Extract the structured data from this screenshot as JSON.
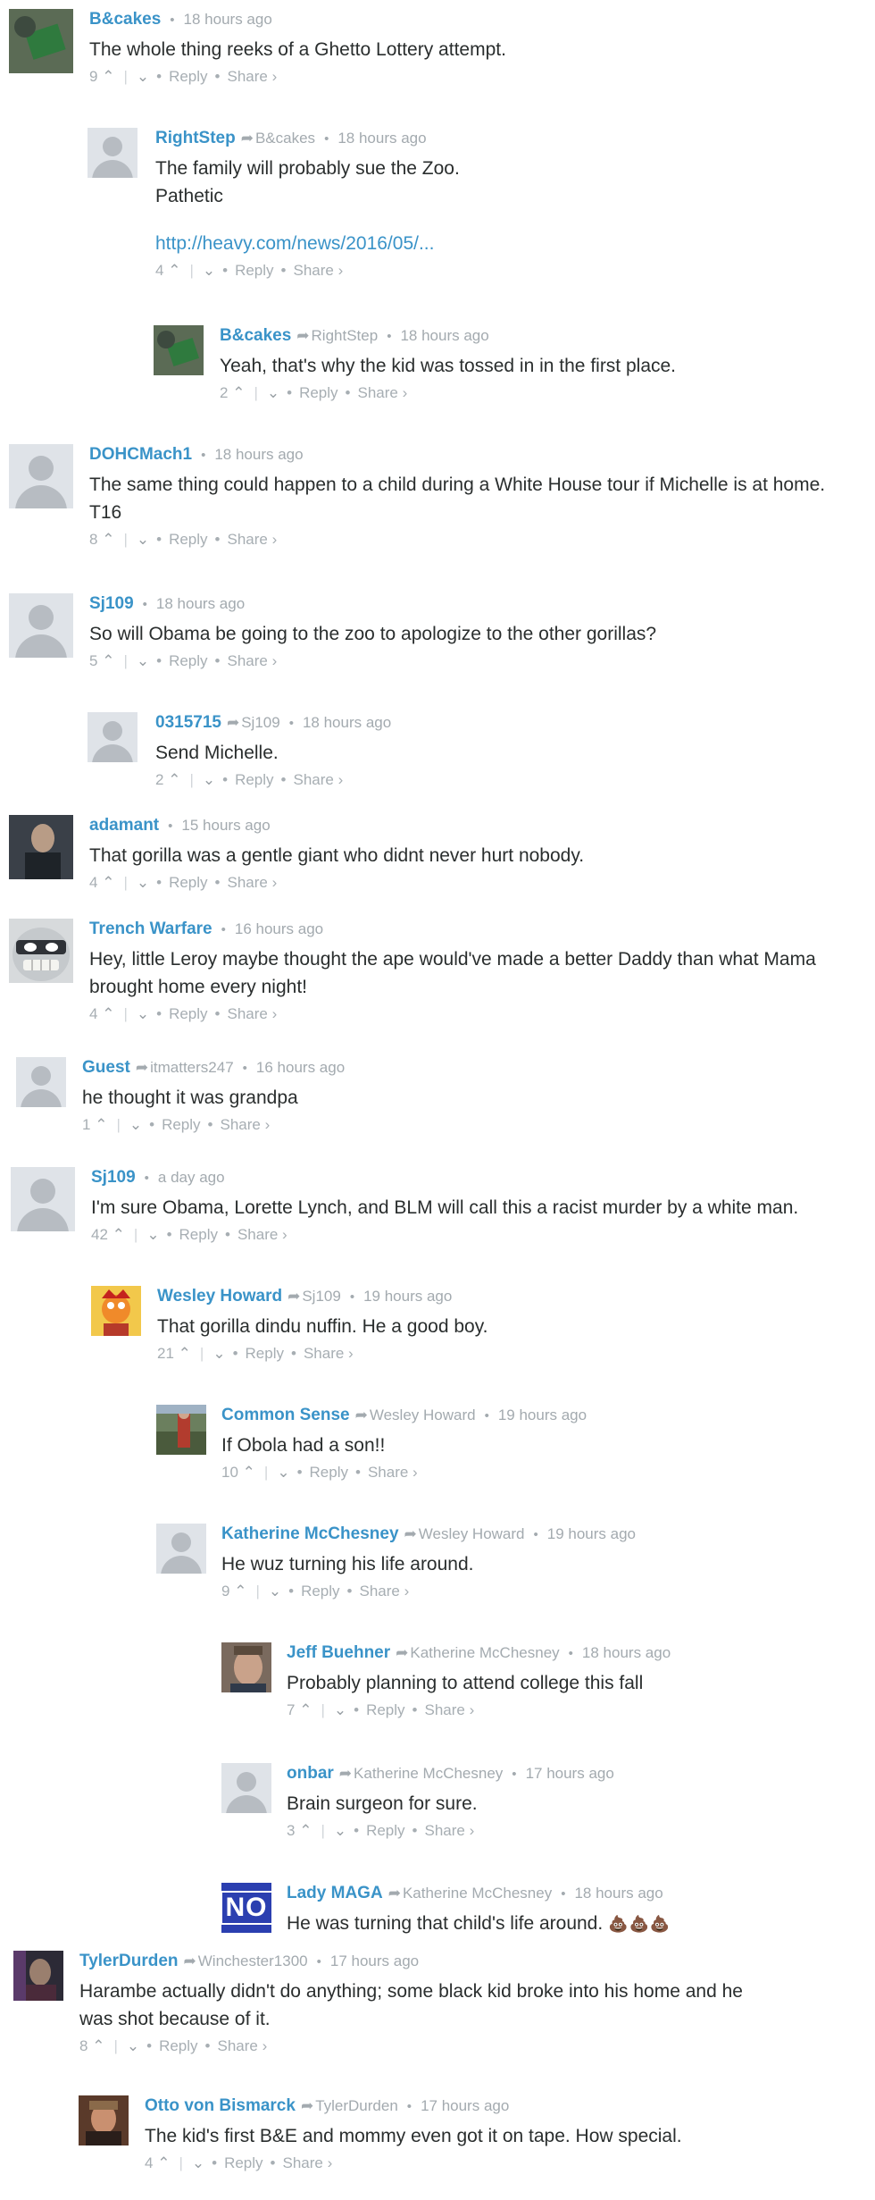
{
  "ui": {
    "reply": "Reply",
    "share": "Share ›",
    "dot": "•",
    "sep": "·",
    "up": "⌃",
    "down": "⌄",
    "bar": "|"
  },
  "comments": [
    {
      "author": "B&cakes",
      "parent": "",
      "time": "18 hours ago",
      "lines": [
        "The whole thing reeks of a Ghetto Lottery attempt."
      ],
      "votes": "9"
    },
    {
      "author": "RightStep",
      "parent": "B&cakes",
      "time": "18 hours ago",
      "lines": [
        "The family will probably sue the Zoo.",
        "Pathetic"
      ],
      "link": "http://heavy.com/news/2016/05/...",
      "votes": "4"
    },
    {
      "author": "B&cakes",
      "parent": "RightStep",
      "time": "18 hours ago",
      "lines": [
        "Yeah, that's why the kid was tossed in in the first place."
      ],
      "votes": "2"
    },
    {
      "author": "DOHCMach1",
      "parent": "",
      "time": "18 hours ago",
      "lines": [
        "The same thing could happen to a child during a White House tour if Michelle is at home.",
        "T16"
      ],
      "votes": "8"
    },
    {
      "author": "Sj109",
      "parent": "",
      "time": "18 hours ago",
      "lines": [
        "So will Obama be going to the zoo to apologize to the other gorillas?"
      ],
      "votes": "5"
    },
    {
      "author": "0315715",
      "parent": "Sj109",
      "time": "18 hours ago",
      "lines": [
        "Send Michelle."
      ],
      "votes": "2"
    },
    {
      "author": "adamant",
      "parent": "",
      "time": "15 hours ago",
      "lines": [
        "That gorilla was a gentle giant who didnt never hurt nobody."
      ],
      "votes": "4"
    },
    {
      "author": "Trench Warfare",
      "parent": "",
      "time": "16 hours ago",
      "lines": [
        "Hey, little Leroy maybe thought the ape would've made a better Daddy than what Mama",
        "brought home every night!"
      ],
      "votes": "4"
    },
    {
      "author": "Guest",
      "parent": "itmatters247",
      "time": "16 hours ago",
      "lines": [
        "he thought it was grandpa"
      ],
      "votes": "1"
    },
    {
      "author": "Sj109",
      "parent": "",
      "time": "a day ago",
      "lines": [
        "I'm sure Obama, Lorette Lynch, and BLM will call this a racist murder by a white man."
      ],
      "votes": "42"
    },
    {
      "author": "Wesley Howard",
      "parent": "Sj109",
      "time": "19 hours ago",
      "lines": [
        "That gorilla dindu nuffin. He a good boy."
      ],
      "votes": "21"
    },
    {
      "author": "Common Sense",
      "parent": "Wesley Howard",
      "time": "19 hours ago",
      "lines": [
        "If Obola had a son!!"
      ],
      "votes": "10"
    },
    {
      "author": "Katherine McChesney",
      "parent": "Wesley Howard",
      "time": "19 hours ago",
      "lines": [
        "He wuz turning his life around."
      ],
      "votes": "9"
    },
    {
      "author": "Jeff Buehner",
      "parent": "Katherine McChesney",
      "time": "18 hours ago",
      "lines": [
        "Probably planning to attend college this fall"
      ],
      "votes": "7"
    },
    {
      "author": "onbar",
      "parent": "Katherine McChesney",
      "time": "17 hours ago",
      "lines": [
        "Brain surgeon for sure."
      ],
      "votes": "3"
    },
    {
      "author": "Lady MAGA",
      "parent": "Katherine McChesney",
      "time": "18 hours ago",
      "lines": [
        "He was turning that child's life around."
      ],
      "emoji": "💩💩💩",
      "badge": "NO",
      "votes": ""
    },
    {
      "author": "TylerDurden",
      "parent": "Winchester1300",
      "time": "17 hours ago",
      "lines": [
        "Harambe actually didn't do anything; some black kid broke into his home and he",
        "was shot because of it."
      ],
      "votes": "8"
    },
    {
      "author": "Otto von Bismarck",
      "parent": "TylerDurden",
      "time": "17 hours ago",
      "lines": [
        "The kid's first B&E and mommy even got it on tape. How special."
      ],
      "votes": "4"
    }
  ]
}
